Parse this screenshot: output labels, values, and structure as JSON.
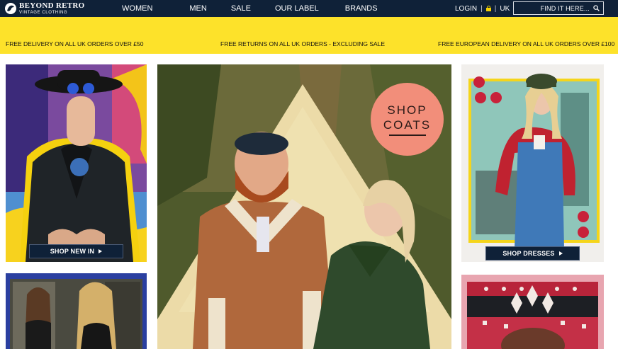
{
  "header": {
    "logo_title": "BEYOND RETRO",
    "logo_subtitle": "VINTAGE CLOTHING",
    "nav": [
      "WOMEN",
      "MEN",
      "SALE",
      "OUR LABEL",
      "BRANDS"
    ],
    "login_label": "LOGIN",
    "separator": "|",
    "region_label": "UK",
    "search_placeholder": "FIND IT HERE..."
  },
  "promo": {
    "items": [
      "FREE DELIVERY ON ALL UK ORDERS OVER £50",
      "FREE RETURNS ON ALL UK ORDERS - EXCLUDING SALE",
      "FREE EUROPEAN DELIVERY ON ALL UK ORDERS OVER £100"
    ]
  },
  "tiles": {
    "new_in_button": "SHOP NEW IN",
    "dresses_button": "SHOP DRESSES",
    "coats_line1": "SHOP",
    "coats_line2": "COATS"
  },
  "colors": {
    "nav_bg": "#0f2138",
    "promo_bg": "#fde22a",
    "coats_badge": "#f28e7a",
    "accent_yellow": "#f6d200"
  }
}
